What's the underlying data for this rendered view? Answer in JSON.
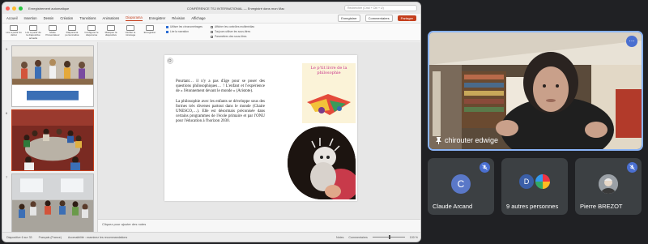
{
  "ppt": {
    "autosave_label": "Enregistrement automatique",
    "window_title": "CONFÉRENCE TSJ INTERNATIONAL — Enregistré dans mon Mac",
    "search_placeholder": "Rechercher (Cmd + Ctrl + U)",
    "menu": [
      "Accueil",
      "Insertion",
      "Dessin",
      "Création",
      "Transitions",
      "Animations",
      "Diaporama",
      "Enregistrer",
      "Révision",
      "Affichage"
    ],
    "active_menu": "Diaporama",
    "present_label": "Enregistrer",
    "comments_label": "Commentaires",
    "share_label": "Partager",
    "ribbon": [
      "Lire à partir du début",
      "Lire à partir de la diapositive actuelle",
      "Mode Présentateur",
      "Diaporama personnalisé",
      "Configurer le diaporama",
      "Masquer la diapositive",
      "Vérifier le minutage",
      "Enregistrer"
    ],
    "ribbon_options": [
      {
        "label": "Utiliser les chronométrages",
        "checked": true
      },
      {
        "label": "Lire la narration",
        "checked": true
      },
      {
        "label": "Afficher les contrôles multimédias",
        "checked": false
      },
      {
        "label": "Toujours utiliser les sous-titres",
        "checked": false
      },
      {
        "label": "Paramètres des sous-titres",
        "checked": false
      }
    ],
    "thumbs": [
      {
        "num": "5"
      },
      {
        "num": "6"
      },
      {
        "num": "7"
      }
    ],
    "thumb5_caption": "Pourquoi la philosophie avec les enfants et les adolescents",
    "slide": {
      "para1": "Pourtant… il n'y a pas d'âge pour se poser des questions philosophiques… ! L'enfant et l'expérience de « l'étonnement devant le monde » (Aristote).",
      "para2": "La philosophie avec les enfants se développe sous des formes très diverses partout dans le monde (Chaire UNESCO,…). Elle est désormais préconisée dans certains programmes de l'école primaire et par l'ONU pour l'éducation à l'horizon 2030.",
      "book_title": "Le p'tit livre de la philosophie"
    },
    "notes_placeholder": "Cliquez pour ajouter des notes",
    "status": {
      "slide_counter": "Diapositive 6 sur 33",
      "language": "Français (France)",
      "accessibility": "Accessibilité : examinez les recommandations",
      "notes": "Notes",
      "comments": "Commentaires",
      "zoom": "100 %"
    }
  },
  "meeting": {
    "main_speaker": "chirouter edwige",
    "tiles": [
      {
        "name": "Claude Arcand",
        "initial": "C"
      },
      {
        "name": "9 autres personnes",
        "initial": "D"
      },
      {
        "name": "Pierre BREZOT",
        "initial": ""
      }
    ]
  },
  "colors": {
    "accent": "#c43e1c",
    "meet_blue": "#8ab4f8",
    "mute_badge": "#4a6fd0"
  }
}
